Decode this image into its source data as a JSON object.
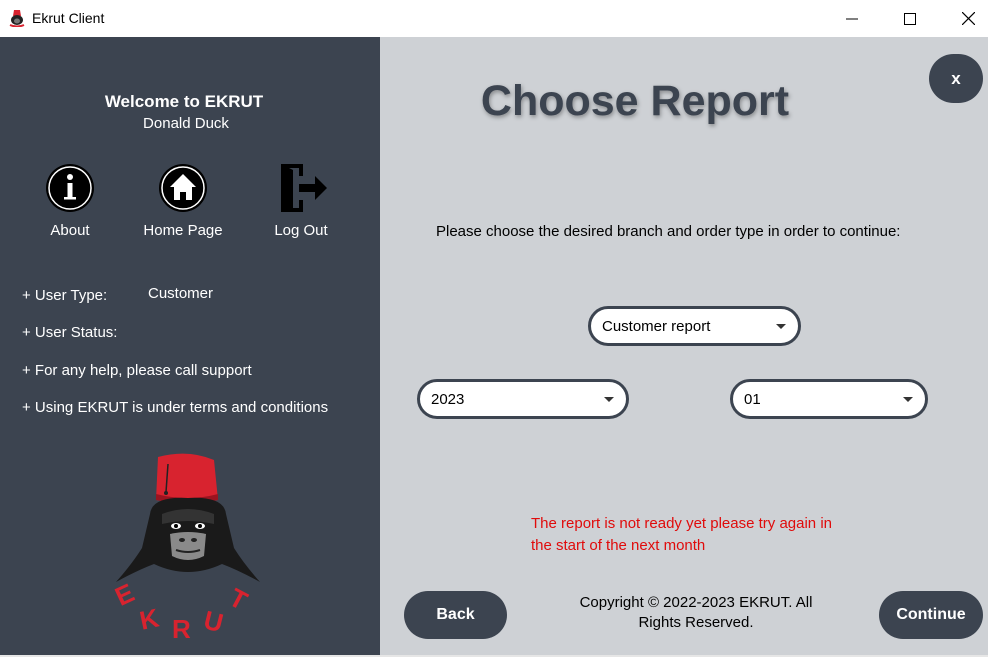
{
  "window": {
    "title": "Ekrut Client"
  },
  "sidebar": {
    "welcome": "Welcome to EKRUT",
    "username": "Donald Duck",
    "nav": {
      "about": "About",
      "home": "Home Page",
      "logout": "Log Out"
    },
    "info": {
      "user_type_label": "+ User Type:",
      "user_type_value": "Customer",
      "user_status_label": "+ User Status:",
      "help": "+ For any help, please call support",
      "terms": "+ Using EKRUT is under terms and conditions"
    },
    "logo_text": "EKRUT"
  },
  "main": {
    "heading": "Choose Report",
    "close_label": "x",
    "instruction": "Please choose the desired branch and order type in order to continue:",
    "report_type": "Customer report",
    "year": "2023",
    "month": "01",
    "error_line1": "The report is not ready yet please try again in",
    "error_line2": "the start of the next month",
    "back_label": "Back",
    "continue_label": "Continue",
    "copyright_line1": "Copyright © 2022-2023 EKRUT. All",
    "copyright_line2": "Rights Reserved."
  },
  "colors": {
    "sidebar_bg": "#3c4450",
    "main_bg": "#ced1d5",
    "accent": "#3c4450",
    "error": "#e00b0b",
    "logo_red": "#d8232f"
  }
}
